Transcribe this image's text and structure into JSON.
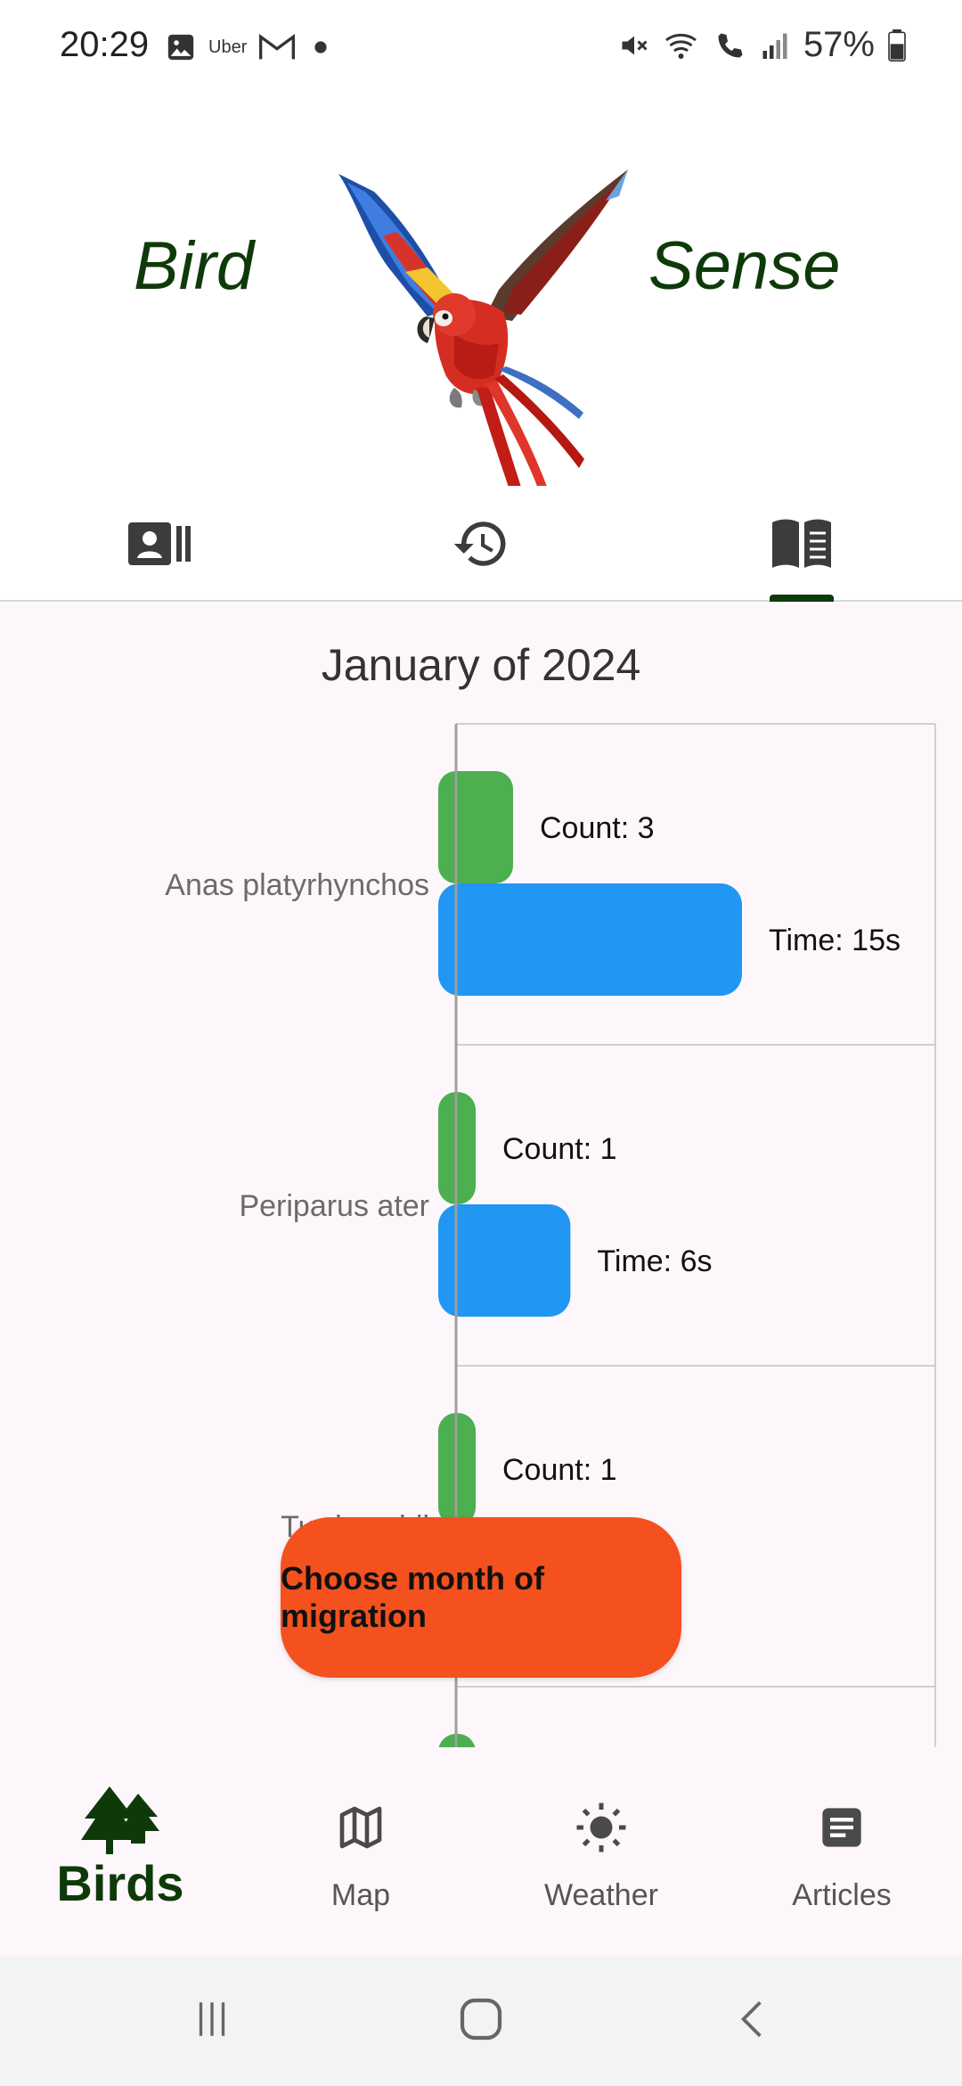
{
  "status": {
    "time": "20:29",
    "left_icons": [
      "image-icon",
      "uber-icon",
      "gmail-icon",
      "dot-icon"
    ],
    "uber_label": "Uber",
    "right_icons": [
      "mute-icon",
      "wifi-call-icon",
      "volte-call-icon",
      "signal-icon"
    ],
    "battery": "57%"
  },
  "header": {
    "brand_left": "Bird",
    "brand_right": "Sense",
    "logo_icon": "parrot-icon"
  },
  "tabs": [
    {
      "icon": "contact-list-icon",
      "active": false
    },
    {
      "icon": "history-icon",
      "active": false
    },
    {
      "icon": "book-icon",
      "active": true
    }
  ],
  "chart_data": {
    "type": "bar",
    "orientation": "horizontal",
    "title": "January of 2024",
    "categories": [
      "Anas platyrhynchos",
      "Periparus ater",
      "Turdus philomelos"
    ],
    "visible_categories_text": [
      "Anas platyrhynchos",
      "Periparus ater",
      "Turdus phil"
    ],
    "series": [
      {
        "key": "count",
        "values": [
          3,
          1,
          1
        ],
        "labels": [
          "Count: 3",
          "Count: 1",
          "Count: 1"
        ],
        "color": "#4caf50"
      },
      {
        "key": "time",
        "values": [
          15,
          6,
          null
        ],
        "labels": [
          "Time: 15s",
          "Time: 6s",
          ""
        ],
        "color": "#2196f3"
      }
    ],
    "grid": true
  },
  "fab": {
    "label": "Choose month of migration",
    "color": "#f4511e"
  },
  "bottom_nav": [
    {
      "label": "Birds",
      "icon": "trees-icon",
      "active": true
    },
    {
      "label": "Map",
      "icon": "map-icon",
      "active": false
    },
    {
      "label": "Weather",
      "icon": "sun-icon",
      "active": false
    },
    {
      "label": "Articles",
      "icon": "article-icon",
      "active": false
    }
  ],
  "colors": {
    "brand_green": "#0e3a0a",
    "accent_orange": "#f4511e",
    "count_green": "#4caf50",
    "time_blue": "#2196f3"
  }
}
